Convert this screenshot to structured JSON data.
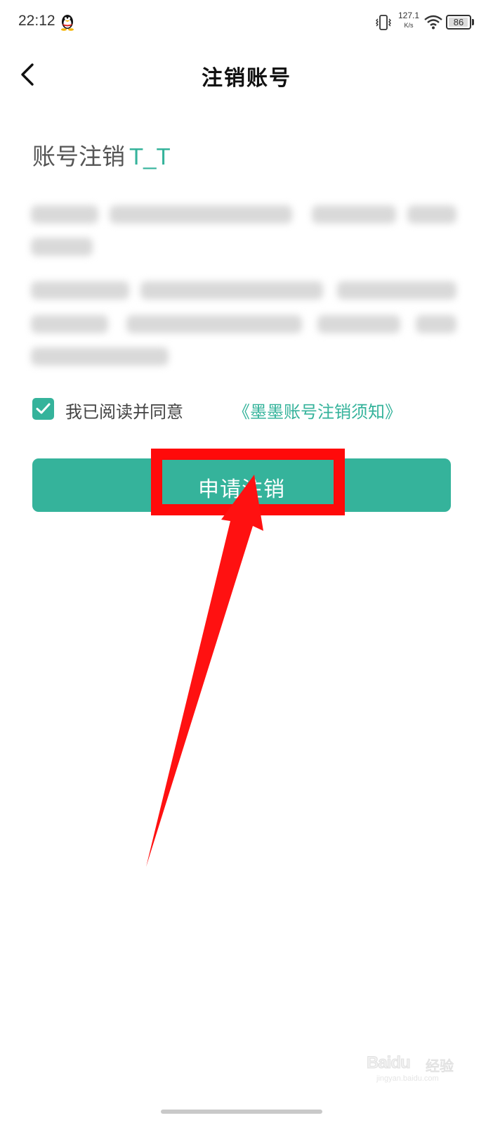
{
  "status_bar": {
    "time": "22:12",
    "network_speed_value": "127.1",
    "network_speed_unit": "K/s",
    "battery_level": "86",
    "icons": [
      "qq-icon",
      "vibrate-icon",
      "wifi-icon",
      "battery-icon"
    ]
  },
  "nav": {
    "title": "注销账号",
    "back_icon": "chevron-left-icon"
  },
  "content": {
    "heading": "账号注销",
    "heading_emote": "T_T",
    "agreement": {
      "checked": true,
      "text": "我已阅读并同意",
      "link_text": "《墨墨账号注销须知》"
    },
    "apply_button_label": "申请注销"
  },
  "annotation": {
    "highlight_color": "#ff0a0a"
  },
  "watermark": {
    "logo": "Baidu",
    "product": "经验",
    "url": "jingyan.baidu.com"
  },
  "colors": {
    "accent": "#35b39b",
    "annotation_red": "#ff0a0a"
  }
}
